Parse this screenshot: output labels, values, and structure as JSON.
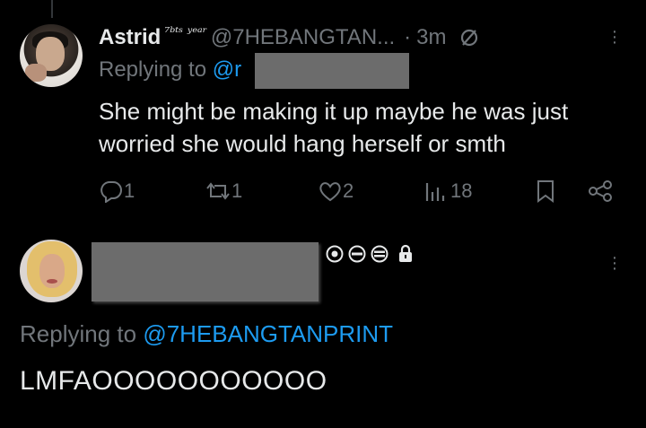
{
  "tweet1": {
    "display_name": "Astrid",
    "name_emoji": "⁷ᵇᵗˢ ʸᵉᵃʳ",
    "handle": "@7HEBANGTAN...",
    "separator": "·",
    "time": "3m",
    "replying_to_label": "Replying to",
    "replying_to_mention": "@r",
    "text": "She might be making it up maybe he was just worried she would hang herself or smth",
    "reply_count": "1",
    "repost_count": "1",
    "like_count": "2",
    "view_count": "18"
  },
  "tweet2": {
    "replying_to_label": "Replying to",
    "replying_to_mention": "@7HEBANGTANPRINT",
    "text": "LMFAOOOOOOOOOOO"
  },
  "colors": {
    "background": "#000000",
    "text": "#e7e9ea",
    "secondary": "#71767b",
    "accent": "#1d9bf0",
    "redaction": "#6c6c6c"
  }
}
